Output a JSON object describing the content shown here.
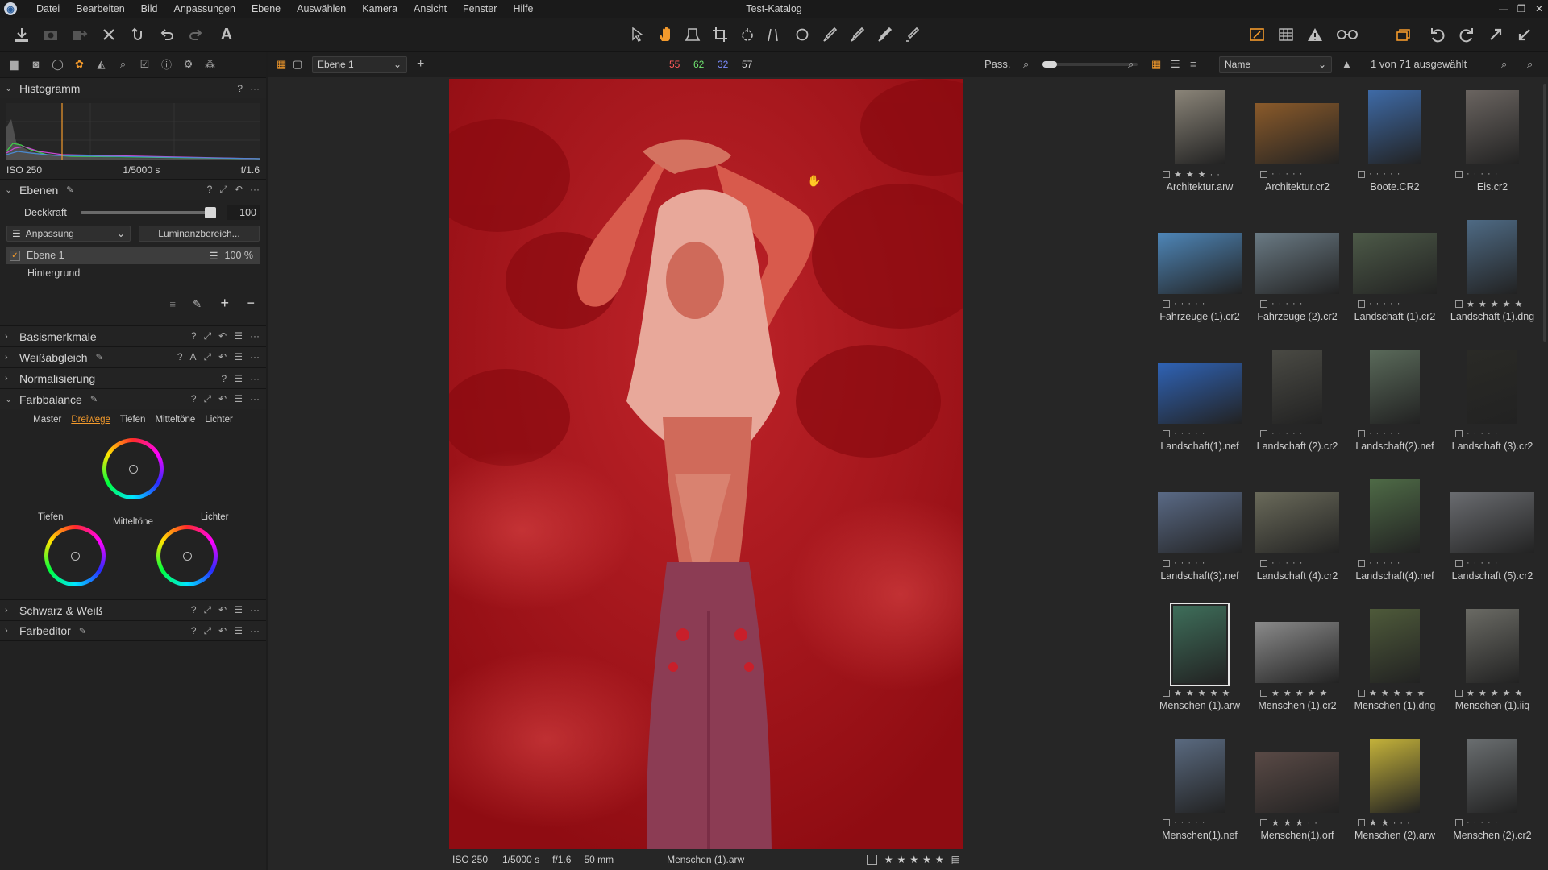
{
  "menubar": {
    "items": [
      "Datei",
      "Bearbeiten",
      "Bild",
      "Anpassungen",
      "Ebene",
      "Auswählen",
      "Kamera",
      "Ansicht",
      "Fenster",
      "Hilfe"
    ],
    "title": "Test-Katalog"
  },
  "histogram": {
    "title": "Histogramm",
    "iso": "ISO 250",
    "shutter": "1/5000 s",
    "aperture": "f/1.6"
  },
  "layers": {
    "title": "Ebenen",
    "opacity_label": "Deckkraft",
    "opacity_value": "100",
    "opacity": 100,
    "adjust_dropdown": "Anpassung",
    "luminance_button": "Luminanzbereich...",
    "layer1_name": "Ebene 1",
    "layer1_opacity": "100 %",
    "background_name": "Hintergrund"
  },
  "sections": {
    "basis": "Basismerkmale",
    "weiss": "Weißabgleich",
    "norm": "Normalisierung",
    "farbbalance": "Farbbalance",
    "sw": "Schwarz & Weiß",
    "farbeditor": "Farbeditor"
  },
  "colorbalance": {
    "tabs": [
      "Master",
      "Dreiwege",
      "Tiefen",
      "Mitteltöne",
      "Lichter"
    ],
    "active_tab": "Dreiwege",
    "labels": {
      "tiefen": "Tiefen",
      "mittel": "Mitteltöne",
      "lichter": "Lichter"
    }
  },
  "viewer": {
    "layer_select": "Ebene 1",
    "readout": {
      "r": "55",
      "g": "62",
      "b": "32",
      "l": "57"
    },
    "readout_colors": {
      "r": "#ff5a5a",
      "g": "#6fe36f",
      "b": "#7c8cff",
      "l": "#d0d0d0"
    },
    "zoom_label": "Pass.",
    "status": {
      "iso": "ISO 250",
      "shutter": "1/5000 s",
      "aperture": "f/1.6",
      "focal": "50 mm",
      "file": "Menschen (1).arw"
    }
  },
  "browser": {
    "sort_field": "Name",
    "selection": "1 von 71 ausgewählt",
    "thumbs": [
      {
        "name": "Architektur.arw",
        "stars": 3,
        "color": "#8a8478"
      },
      {
        "name": "Architektur.cr2",
        "stars": 0,
        "color": "#8a5a2a"
      },
      {
        "name": "Boote.CR2",
        "stars": 0,
        "color": "#3e6aa6"
      },
      {
        "name": "Eis.cr2",
        "stars": 0,
        "color": "#6a6460"
      },
      {
        "name": "Fahrzeuge (1).cr2",
        "stars": 0,
        "color": "#4e86b8"
      },
      {
        "name": "Fahrzeuge (2).cr2",
        "stars": 0,
        "color": "#6a7a84"
      },
      {
        "name": "Landschaft (1).cr2",
        "stars": 0,
        "color": "#4d5a48"
      },
      {
        "name": "Landschaft (1).dng",
        "stars": 5,
        "color": "#4e6a84"
      },
      {
        "name": "Landschaft(1).nef",
        "stars": 0,
        "color": "#2f63b6"
      },
      {
        "name": "Landschaft (2).cr2",
        "stars": 0,
        "color": "#4a4a44"
      },
      {
        "name": "Landschaft(2).nef",
        "stars": 0,
        "color": "#5a6a5a"
      },
      {
        "name": "Landschaft (3).cr2",
        "stars": 0,
        "color": "#2a2a26"
      },
      {
        "name": "Landschaft(3).nef",
        "stars": 0,
        "color": "#5a6a86"
      },
      {
        "name": "Landschaft (4).cr2",
        "stars": 0,
        "color": "#6a6a5a"
      },
      {
        "name": "Landschaft(4).nef",
        "stars": 0,
        "color": "#4e6a46"
      },
      {
        "name": "Landschaft (5).cr2",
        "stars": 0,
        "color": "#6a6c70"
      },
      {
        "name": "Menschen (1).arw",
        "stars": 5,
        "color": "#3e6e5a"
      },
      {
        "name": "Menschen (1).cr2",
        "stars": 5,
        "color": "#8a8a8a"
      },
      {
        "name": "Menschen (1).dng",
        "stars": 5,
        "color": "#4e5a3a"
      },
      {
        "name": "Menschen (1).iiq",
        "stars": 5,
        "color": "#6a6a64"
      },
      {
        "name": "Menschen(1).nef",
        "stars": 0,
        "color": "#5a6a80"
      },
      {
        "name": "Menschen(1).orf",
        "stars": 3,
        "color": "#5a4a46"
      },
      {
        "name": "Menschen (2).arw",
        "stars": 2,
        "color": "#c4b23a"
      },
      {
        "name": "Menschen (2).cr2",
        "stars": 0,
        "color": "#6a6e70"
      }
    ]
  }
}
